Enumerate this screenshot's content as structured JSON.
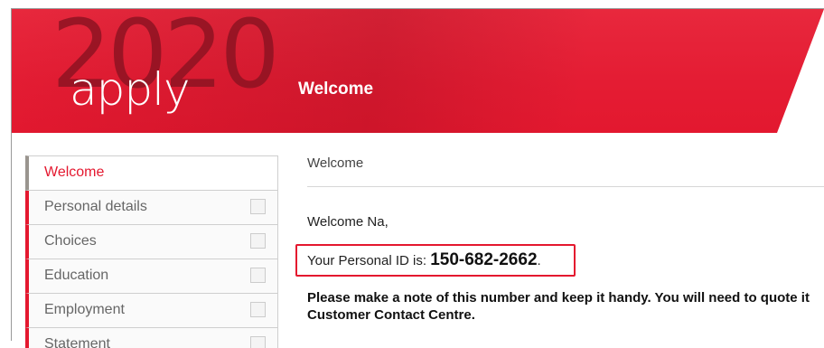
{
  "header": {
    "year": "2020",
    "logo_text": "apply",
    "page_title": "Welcome",
    "brand_color": "#e4182f"
  },
  "sidebar": {
    "items": [
      {
        "label": "Welcome",
        "active": true
      },
      {
        "label": "Personal details",
        "checked": false
      },
      {
        "label": "Choices",
        "checked": false
      },
      {
        "label": "Education",
        "checked": false
      },
      {
        "label": "Employment",
        "checked": false
      },
      {
        "label": "Statement",
        "checked": false
      }
    ]
  },
  "main": {
    "breadcrumb": "Welcome",
    "greeting": "Welcome Na,",
    "id_prefix": "Your Personal ID is: ",
    "personal_id": "150-682-2662",
    "id_suffix": ".",
    "note_line1": "Please make a note of this number and keep it handy. You will need to quote it",
    "note_line2": "Customer Contact Centre."
  }
}
